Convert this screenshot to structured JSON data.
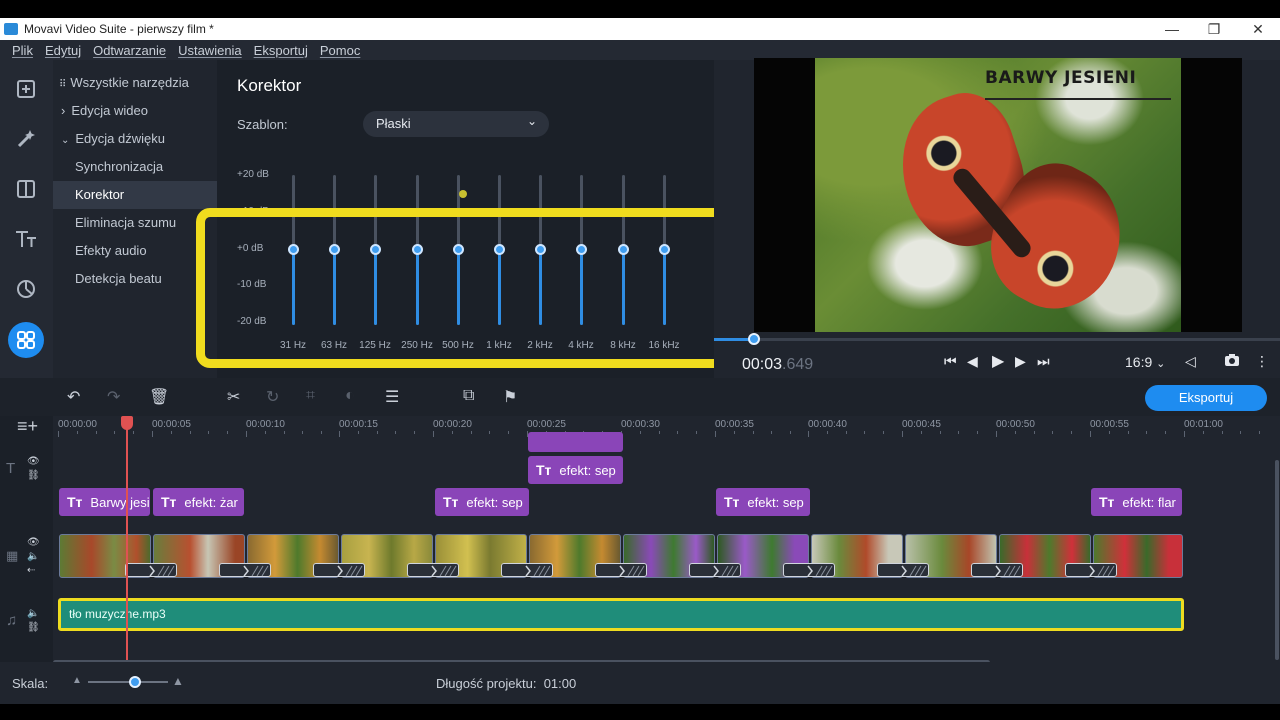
{
  "window": {
    "title": "Movavi Video Suite - pierwszy film *",
    "controls": [
      "—",
      "❐",
      "✕"
    ]
  },
  "menu": [
    "Plik",
    "Edytuj",
    "Odtwarzanie",
    "Ustawienia",
    "Eksportuj",
    "Pomoc"
  ],
  "toolbar_icons": [
    "import-icon",
    "magic-wand-icon",
    "filters-icon",
    "titles-icon",
    "stickers-icon",
    "more-tools-icon"
  ],
  "tools": {
    "all_tools": "Wszystkie narzędzia",
    "video_edit": "Edycja wideo",
    "audio_edit": "Edycja dźwięku",
    "items": [
      "Synchronizacja",
      "Korektor",
      "Eliminacja szumu",
      "Efekty audio",
      "Detekcja beatu"
    ],
    "selected": "Korektor"
  },
  "equalizer": {
    "title": "Korektor",
    "preset_label": "Szablon:",
    "preset_value": "Płaski",
    "db_labels": [
      "+20 dB",
      "+10 dB",
      "+0 dB",
      "-10 dB",
      "-20 dB"
    ],
    "bands": [
      "31 Hz",
      "63 Hz",
      "125 Hz",
      "250 Hz",
      "500 Hz",
      "1 kHz",
      "2 kHz",
      "4 kHz",
      "8 kHz",
      "16 kHz"
    ],
    "band_gains_db": [
      0,
      0,
      0,
      0,
      0,
      0,
      0,
      0,
      0,
      0
    ]
  },
  "player": {
    "video_title": "BARWY JESIENI",
    "timecode_main": "00:03",
    "timecode_ms": ".649",
    "aspect": "16:9",
    "progress_fraction": 0.06
  },
  "timeline_toolbar": {
    "export_label": "Eksportuj"
  },
  "timeline": {
    "ruler": [
      "00:00:00",
      "00:00:05",
      "00:00:10",
      "00:00:15",
      "00:00:20",
      "00:00:25",
      "00:00:30",
      "00:00:35",
      "00:00:40",
      "00:00:45",
      "00:00:50",
      "00:00:55",
      "00:01:00"
    ],
    "titles_row1": [
      "efekt: sep"
    ],
    "titles_row2": [
      "Barwy jesi",
      "efekt: żar",
      "efekt: sep",
      "efekt: sep",
      "efekt: flar"
    ],
    "audio_clip": "tło muzyczne.mp3"
  },
  "bottom": {
    "scale_label": "Skala:",
    "length_label": "Długość projektu:",
    "length_value": "01:00"
  },
  "colors": {
    "accent": "#1e8cf0",
    "title_clip": "#8a45b8",
    "audio_clip": "#1f8d7a",
    "highlight": "#f0dc1e",
    "playhead": "#e05252"
  }
}
